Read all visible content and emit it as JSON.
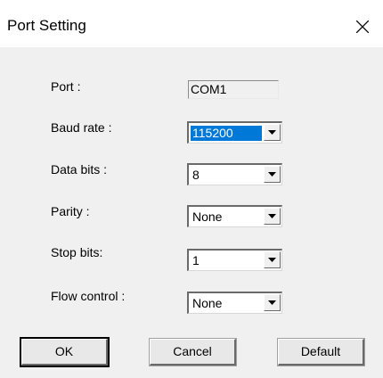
{
  "window": {
    "title": "Port Setting"
  },
  "fields": {
    "port": {
      "label": "Port :",
      "value": "COM1"
    },
    "baud_rate": {
      "label": "Baud rate :",
      "value": "115200"
    },
    "data_bits": {
      "label": "Data bits :",
      "value": "8"
    },
    "parity": {
      "label": "Parity :",
      "value": "None"
    },
    "stop_bits": {
      "label": "Stop bits:",
      "value": "1"
    },
    "flow_control": {
      "label": "Flow control :",
      "value": "None"
    }
  },
  "buttons": {
    "ok": "OK",
    "cancel": "Cancel",
    "default": "Default"
  },
  "icons": {
    "close": "close-icon",
    "dropdown": "chevron-down-icon"
  },
  "colors": {
    "selection": "#0078d7",
    "titlebar": "#ffffff",
    "dialog": "#f0f0f0"
  }
}
